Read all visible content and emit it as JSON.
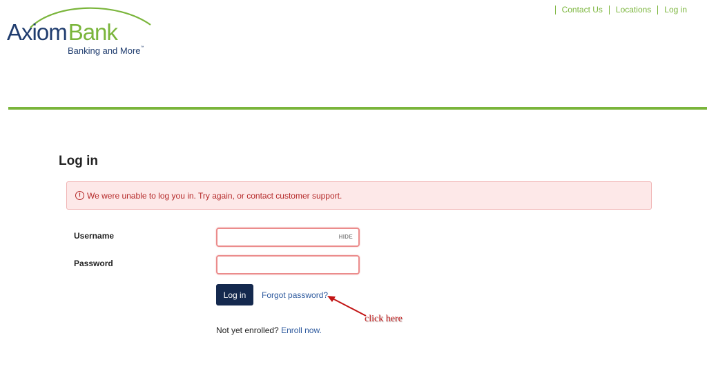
{
  "brand": {
    "name_part1": "Axiom",
    "name_part2": "Bank",
    "tagline": "Banking and More",
    "tagline_mark": "™",
    "colors": {
      "navy": "#1f3c6e",
      "green": "#7ab53b"
    }
  },
  "topnav": {
    "items": [
      {
        "label": "Contact Us"
      },
      {
        "label": "Locations"
      },
      {
        "label": "Log in"
      }
    ]
  },
  "main": {
    "title": "Log in",
    "alert": {
      "icon": "exclamation-circle-icon",
      "message": "We were unable to log you in. Try again, or contact customer support."
    },
    "form": {
      "username_label": "Username",
      "username_value": "",
      "hide_label": "HIDE",
      "password_label": "Password",
      "password_value": "",
      "login_label": "Log in",
      "forgot_label": "Forgot password?",
      "enroll_text": "Not yet enrolled?",
      "enroll_link": "Enroll now."
    },
    "annotation": {
      "text": "click here",
      "color": "#c21515"
    }
  }
}
